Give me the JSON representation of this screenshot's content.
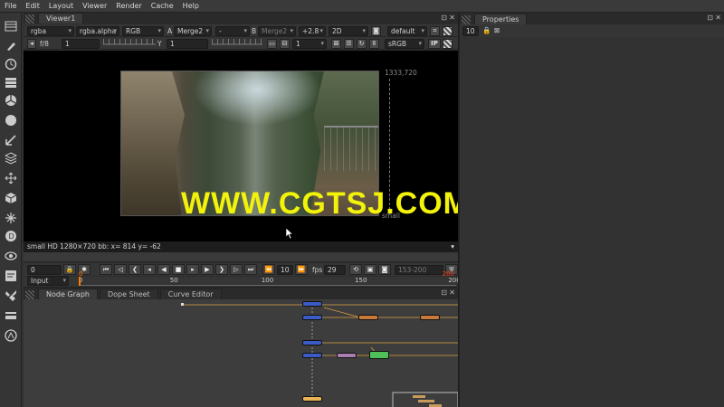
{
  "menu": [
    "File",
    "Edit",
    "Layout",
    "Viewer",
    "Render",
    "Cache",
    "Help"
  ],
  "viewer": {
    "tab_label": "Viewer1",
    "row1": {
      "channels": "rgba",
      "layer": "rgba.alpha",
      "display_channel": "RGB",
      "input_a_label": "A",
      "input_a": "Merge2",
      "compare_mode": "-",
      "input_b_label": "B",
      "input_b": "Merge2",
      "gain": "+2.8",
      "view_mode": "2D",
      "lut": "default"
    },
    "row2": {
      "fstop": "f/8",
      "gain_value": "1",
      "gamma_label": "Y",
      "gamma_value": "1",
      "proxy": "1",
      "colorspace": "sRGB",
      "ip_label": "IP"
    },
    "resolution_label": "1333,720",
    "format_small": "small",
    "info_text": "small HD 1280×720 bb: x= 814 y= -62",
    "watermark": "WWW.CGTSJ.COM"
  },
  "playback": {
    "frame": "0",
    "increment": "10",
    "fps_label": "fps",
    "fps": "29",
    "range": "153-200",
    "input_mode": "Input"
  },
  "timeline": {
    "ticks": [
      "0",
      "50",
      "100",
      "150",
      "200"
    ],
    "start_marker": "0",
    "end_marker": "200",
    "current_frame": 0,
    "first_frame": 0,
    "last_frame": 200
  },
  "nodegraph": {
    "tabs": [
      "Node Graph",
      "Dope Sheet",
      "Curve Editor"
    ]
  },
  "properties": {
    "tab_label": "Properties",
    "max_panels": "10"
  },
  "colors": {
    "read_node": "#3b5bc6",
    "merge_node": "#c87a3c",
    "grade_node": "#a77fb0",
    "color_node": "#4fbf5a",
    "write_node": "#e8b454",
    "link_line": "#b5893f",
    "watermark": "#f2f20a",
    "marker": "#ff7a00"
  }
}
